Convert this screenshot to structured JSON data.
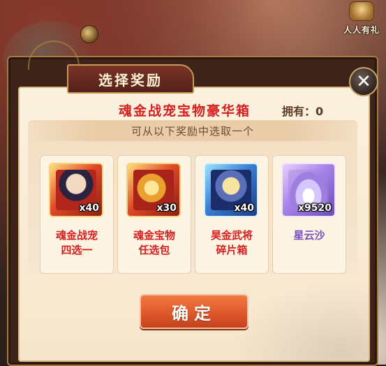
{
  "corner": {
    "gift_label": "人人有礼"
  },
  "dialog": {
    "title": "选择奖励",
    "close_glyph": "✕",
    "chest_name": "魂金战宠宝物豪华箱",
    "owned_label": "拥有：0",
    "instruction": "可从以下奖励中选取一个",
    "rewards": [
      {
        "count": "x40",
        "label": "魂金战宠\n四选一",
        "label_color": "#d61f1f",
        "frame": "red",
        "icon": "pet-portrait-icon"
      },
      {
        "count": "x30",
        "label": "魂金宝物\n任选包",
        "label_color": "#d61f1f",
        "frame": "red",
        "icon": "treasure-icon"
      },
      {
        "count": "x40",
        "label": "昊金武将\n碎片箱",
        "label_color": "#d61f1f",
        "frame": "blue",
        "icon": "general-fragment-icon"
      },
      {
        "count": "x9520",
        "label": "星云沙",
        "label_color": "#7a4ec0",
        "frame": "purple",
        "icon": "nebula-sand-icon"
      }
    ],
    "confirm_label": "确定"
  },
  "colors": {
    "accent_red": "#d61f1f",
    "confirm_orange": "#e0582b",
    "panel_cream": "#fbf1df",
    "frame_brown": "#3e2418"
  }
}
